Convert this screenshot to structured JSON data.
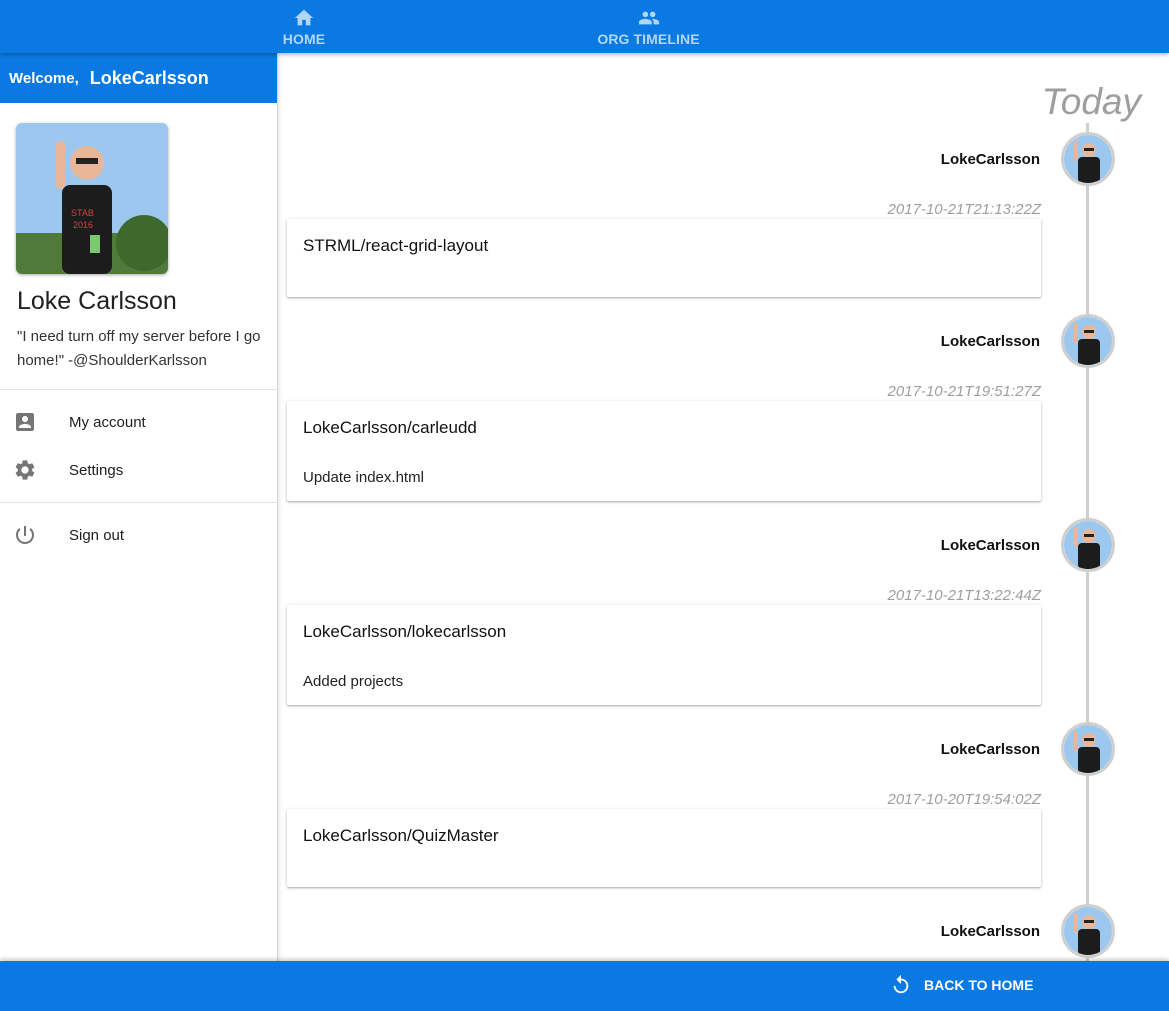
{
  "nav": {
    "tabs": [
      {
        "label": "HOME",
        "icon": "home-icon"
      },
      {
        "label": "ORG TIMELINE",
        "icon": "people-icon"
      }
    ]
  },
  "sidebar": {
    "welcome_label": "Welcome,",
    "username": "LokeCarlsson",
    "profile_name": "Loke Carlsson",
    "quote": "\"I need turn off my server before I go home!\" -@ShoulderKarlsson",
    "menu": [
      {
        "label": "My account",
        "icon": "account-box-icon"
      },
      {
        "label": "Settings",
        "icon": "gear-icon"
      },
      {
        "label": "Sign out",
        "icon": "power-icon"
      }
    ]
  },
  "timeline": {
    "header": "Today",
    "entries": [
      {
        "user": "LokeCarlsson",
        "time": "2017-10-21T21:13:22Z",
        "repo": "STRML/react-grid-layout",
        "message": ""
      },
      {
        "user": "LokeCarlsson",
        "time": "2017-10-21T19:51:27Z",
        "repo": "LokeCarlsson/carleudd",
        "message": "Update index.html"
      },
      {
        "user": "LokeCarlsson",
        "time": "2017-10-21T13:22:44Z",
        "repo": "LokeCarlsson/lokecarlsson",
        "message": "Added projects"
      },
      {
        "user": "LokeCarlsson",
        "time": "2017-10-20T19:54:02Z",
        "repo": "LokeCarlsson/QuizMaster",
        "message": ""
      },
      {
        "user": "LokeCarlsson"
      }
    ]
  },
  "footer": {
    "back_label": "BACK TO HOME",
    "icon": "undo-icon"
  },
  "colors": {
    "primary": "#0a7ae2",
    "tab_inactive": "#b3d6f6",
    "timestamp": "#9e9e9e"
  }
}
